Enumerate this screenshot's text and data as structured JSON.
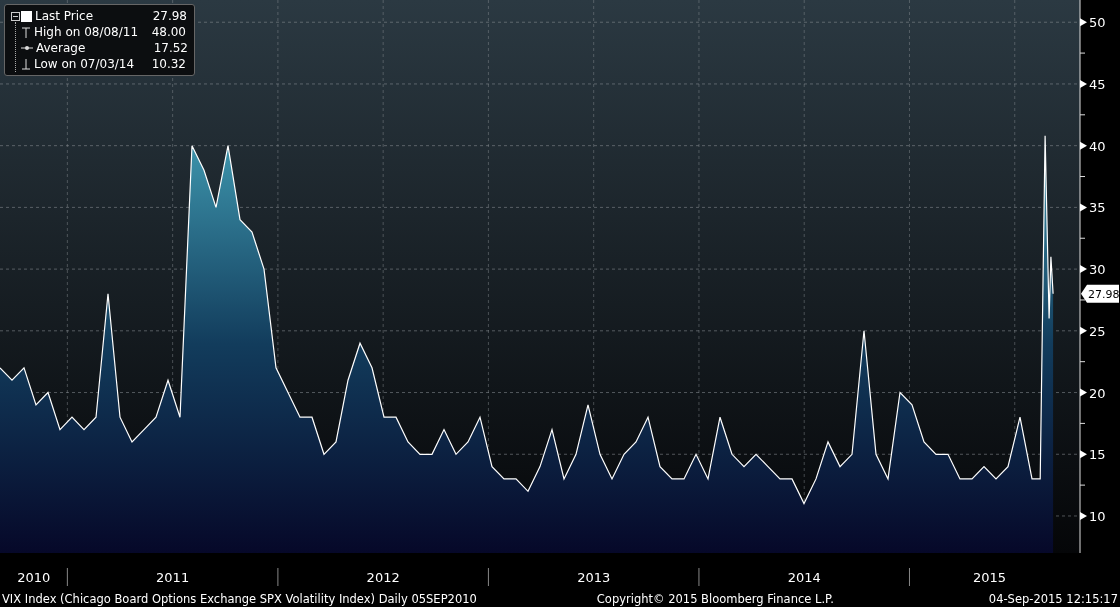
{
  "legend": {
    "items": [
      {
        "kind": "last",
        "value": "27.98"
      },
      {
        "kind": "high",
        "label": "High on 08/08/11",
        "value": "48.00"
      },
      {
        "kind": "average",
        "label": "Average",
        "value": "17.52"
      },
      {
        "kind": "low",
        "label": "Low on 07/03/14",
        "value": "10.32"
      }
    ]
  },
  "chart": {
    "last_price_tag": "27.98",
    "first_segment_label": "2010",
    "chart_data": {
      "type": "area",
      "grid": true,
      "x": [
        2010.68,
        2010.737,
        2010.794,
        2010.851,
        2010.908,
        2010.965,
        2011.022,
        2011.079,
        2011.136,
        2011.193,
        2011.25,
        2011.307,
        2011.364,
        2011.421,
        2011.478,
        2011.535,
        2011.592,
        2011.649,
        2011.706,
        2011.763,
        2011.82,
        2011.877,
        2011.934,
        2011.991,
        2012.048,
        2012.105,
        2012.162,
        2012.219,
        2012.276,
        2012.333,
        2012.39,
        2012.447,
        2012.504,
        2012.561,
        2012.618,
        2012.675,
        2012.732,
        2012.789,
        2012.846,
        2012.903,
        2012.96,
        2013.017,
        2013.074,
        2013.131,
        2013.188,
        2013.245,
        2013.302,
        2013.359,
        2013.416,
        2013.473,
        2013.53,
        2013.587,
        2013.644,
        2013.701,
        2013.758,
        2013.815,
        2013.872,
        2013.929,
        2013.986,
        2014.043,
        2014.1,
        2014.157,
        2014.214,
        2014.271,
        2014.328,
        2014.385,
        2014.442,
        2014.499,
        2014.556,
        2014.613,
        2014.67,
        2014.727,
        2014.784,
        2014.841,
        2014.898,
        2014.955,
        2015.012,
        2015.069,
        2015.126,
        2015.183,
        2015.24,
        2015.297,
        2015.354,
        2015.411,
        2015.468,
        2015.525,
        2015.582,
        2015.621,
        2015.644,
        2015.663,
        2015.672,
        2015.682
      ],
      "series": [
        {
          "name": "Last Price",
          "color": "#ffffff",
          "values": [
            22,
            21,
            22,
            19,
            20,
            17,
            18,
            17,
            18,
            28,
            18,
            16,
            17,
            18,
            21,
            18,
            40,
            38,
            35,
            40,
            34,
            33,
            30,
            22,
            20,
            18,
            18,
            15,
            16,
            21,
            24,
            22,
            18,
            18,
            16,
            15,
            15,
            17,
            15,
            16,
            18,
            14,
            13,
            13,
            12,
            14,
            17,
            13,
            15,
            19,
            15,
            13,
            15,
            16,
            18,
            14,
            13,
            13,
            15,
            13,
            18,
            15,
            14,
            15,
            14,
            13,
            13,
            11,
            13,
            16,
            14,
            15,
            25,
            15,
            13,
            20,
            19,
            16,
            15,
            15,
            13,
            13,
            14,
            13,
            14,
            18,
            13,
            13,
            40.8,
            26,
            31,
            28
          ]
        }
      ],
      "xlim": [
        2010.68,
        2015.81
      ],
      "ylim": [
        7,
        51.8
      ],
      "xticks": [
        {
          "value": 2011.5,
          "label": "2011"
        },
        {
          "value": 2012.5,
          "label": "2012"
        },
        {
          "value": 2013.5,
          "label": "2013"
        },
        {
          "value": 2014.5,
          "label": "2014"
        },
        {
          "value": 2015.38,
          "label": "2015"
        }
      ],
      "yticks": [
        10,
        15,
        20,
        25,
        30,
        35,
        40,
        45,
        50
      ]
    }
  },
  "footer": {
    "description": "VIX Index (Chicago Board Options Exchange SPX Volatility Index)  Daily 05SEP2010",
    "copyright": "Copyright© 2015 Bloomberg Finance L.P.",
    "timestamp": "04-Sep-2015 12:15:17"
  }
}
